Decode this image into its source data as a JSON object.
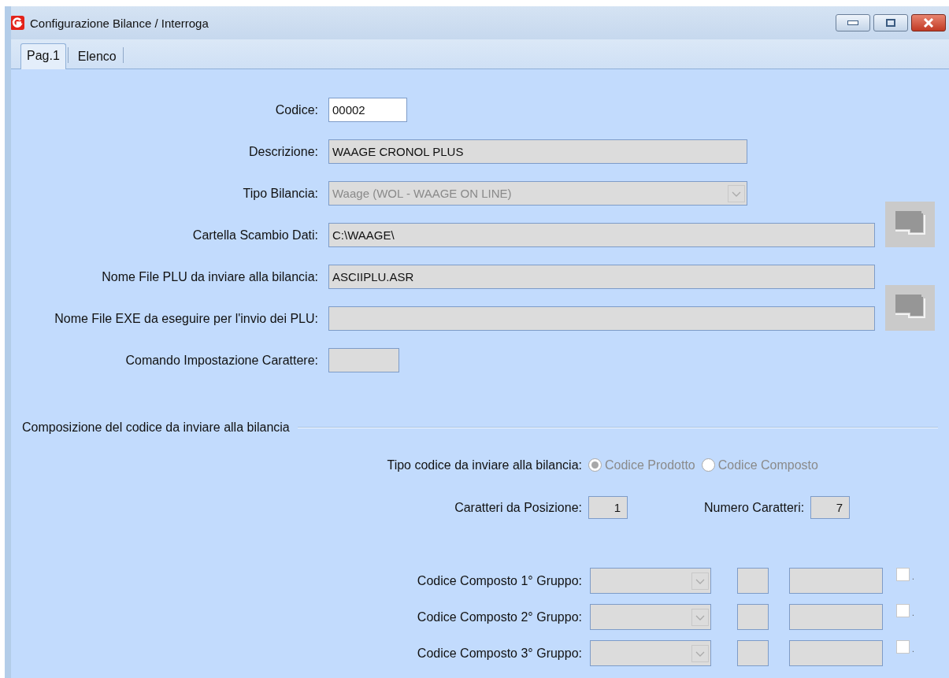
{
  "window": {
    "title": "Configurazione Bilance / Interroga"
  },
  "tabs": [
    {
      "label": "Pag.1",
      "selected": true
    },
    {
      "label": "Elenco",
      "selected": false
    }
  ],
  "fields": [
    {
      "kind": "text",
      "label": "Codice:",
      "value": "00002",
      "disabled": false,
      "browse_button": false
    },
    {
      "kind": "text",
      "label": "Descrizione:",
      "value": "WAAGE CRONOL PLUS",
      "disabled": true,
      "browse_button": false
    },
    {
      "kind": "combo",
      "label": "Tipo Bilancia:",
      "value": "Waage (WOL - WAAGE ON LINE)",
      "disabled": true,
      "browse_button": false
    },
    {
      "kind": "text",
      "label": "Cartella Scambio Dati:",
      "value": "C:\\WAAGE\\",
      "disabled": true,
      "browse_button": true
    },
    {
      "kind": "text",
      "label": "Nome File PLU da inviare alla bilancia:",
      "value": "ASCIIPLU.ASR",
      "disabled": true,
      "browse_button": false
    },
    {
      "kind": "text",
      "label": "Nome File EXE da eseguire per l'invio dei PLU:",
      "disabled": true,
      "browse_button": true
    },
    {
      "kind": "text",
      "label": "Comando Impostazione Carattere:",
      "disabled": true,
      "browse_button": false
    }
  ],
  "composition": {
    "title": "Composizione del codice da inviare alla bilancia",
    "code_type": {
      "label": "Tipo codice da inviare alla bilancia:",
      "disabled": true,
      "options": [
        {
          "label": "Codice Prodotto",
          "selected": true
        },
        {
          "label": "Codice Composto",
          "selected": false
        }
      ]
    },
    "position": {
      "label": "Caratteri da Posizione:",
      "value": "1"
    },
    "count": {
      "label": "Numero Caratteri:",
      "value": "7"
    },
    "groups": [
      {
        "label": "Codice Composto 1° Gruppo:",
        "checked": false,
        "check_label": "."
      },
      {
        "label": "Codice Composto 2° Gruppo:",
        "checked": false,
        "check_label": "."
      },
      {
        "label": "Codice Composto 3° Gruppo:",
        "checked": false,
        "check_label": "."
      }
    ]
  }
}
